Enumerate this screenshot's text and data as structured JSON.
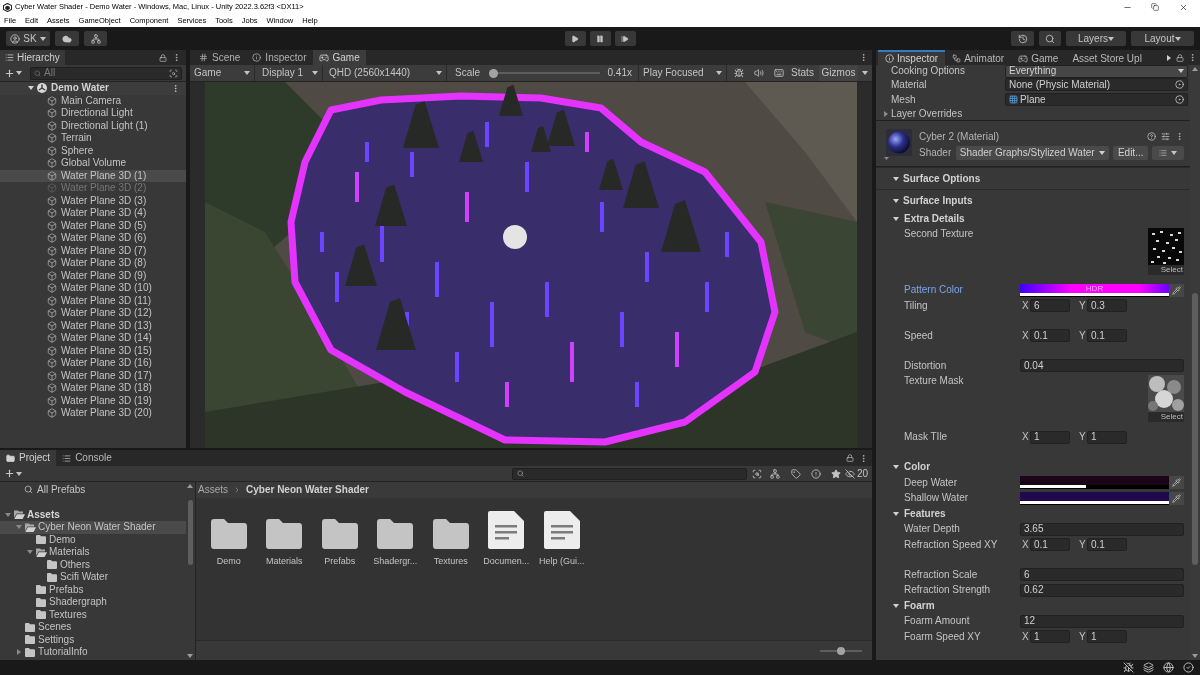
{
  "window": {
    "title": "Cyber Water Shader - Demo Water - Windows, Mac, Linux - Unity 2022.3.62f3 <DX11>"
  },
  "menu": [
    "File",
    "Edit",
    "Assets",
    "GameObject",
    "Component",
    "Services",
    "Tools",
    "Jobs",
    "Window",
    "Help"
  ],
  "toolbar": {
    "account": "SK",
    "layers": "Layers",
    "layout": "Layout"
  },
  "hierarchy": {
    "tab": "Hierarchy",
    "search_placeholder": "All",
    "scene": {
      "label": "Demo Water",
      "expanded": true
    },
    "items": [
      {
        "label": "Main Camera",
        "selected": false,
        "disabled": false
      },
      {
        "label": "Directional Light",
        "selected": false,
        "disabled": false
      },
      {
        "label": "Directional Light (1)",
        "selected": false,
        "disabled": false
      },
      {
        "label": "Terrain",
        "selected": false,
        "disabled": false
      },
      {
        "label": "Sphere",
        "selected": false,
        "disabled": false
      },
      {
        "label": "Global Volume",
        "selected": false,
        "disabled": false
      },
      {
        "label": "Water Plane 3D (1)",
        "selected": true,
        "disabled": false
      },
      {
        "label": "Water Plane 3D (2)",
        "selected": false,
        "disabled": true
      },
      {
        "label": "Water Plane 3D (3)",
        "selected": false,
        "disabled": false
      },
      {
        "label": "Water Plane 3D (4)",
        "selected": false,
        "disabled": false
      },
      {
        "label": "Water Plane 3D (5)",
        "selected": false,
        "disabled": false
      },
      {
        "label": "Water Plane 3D (6)",
        "selected": false,
        "disabled": false
      },
      {
        "label": "Water Plane 3D (7)",
        "selected": false,
        "disabled": false
      },
      {
        "label": "Water Plane 3D (8)",
        "selected": false,
        "disabled": false
      },
      {
        "label": "Water Plane 3D (9)",
        "selected": false,
        "disabled": false
      },
      {
        "label": "Water Plane 3D (10)",
        "selected": false,
        "disabled": false
      },
      {
        "label": "Water Plane 3D (11)",
        "selected": false,
        "disabled": false
      },
      {
        "label": "Water Plane 3D (12)",
        "selected": false,
        "disabled": false
      },
      {
        "label": "Water Plane 3D (13)",
        "selected": false,
        "disabled": false
      },
      {
        "label": "Water Plane 3D (14)",
        "selected": false,
        "disabled": false
      },
      {
        "label": "Water Plane 3D (15)",
        "selected": false,
        "disabled": false
      },
      {
        "label": "Water Plane 3D (16)",
        "selected": false,
        "disabled": false
      },
      {
        "label": "Water Plane 3D (17)",
        "selected": false,
        "disabled": false
      },
      {
        "label": "Water Plane 3D (18)",
        "selected": false,
        "disabled": false
      },
      {
        "label": "Water Plane 3D (19)",
        "selected": false,
        "disabled": false
      },
      {
        "label": "Water Plane 3D (20)",
        "selected": false,
        "disabled": false
      }
    ]
  },
  "game": {
    "tabs": [
      {
        "label": "Scene",
        "selected": false
      },
      {
        "label": "Inspector",
        "selected": false
      },
      {
        "label": "Game",
        "selected": true
      }
    ],
    "mode": "Game",
    "display": "Display 1",
    "resolution": "QHD (2560x1440)",
    "scale": {
      "label": "Scale",
      "level": 0,
      "reading": "0.41x"
    },
    "play_mode": "Play Focused",
    "stats": "Stats",
    "gizmos": "Gizmos"
  },
  "inspector": {
    "tabs": [
      {
        "label": "Inspector",
        "selected": true
      },
      {
        "label": "Animator",
        "selected": false
      },
      {
        "label": "Game",
        "selected": false
      },
      {
        "label": "Asset Store Upl",
        "selected": false
      }
    ],
    "component_rows": [
      {
        "kind": "dropdown",
        "label": "Cooking Options",
        "value": "Everything"
      },
      {
        "kind": "object",
        "label": "Material",
        "value": "None (Physic Material)"
      },
      {
        "kind": "mesh",
        "label": "Mesh",
        "value": "Plane"
      }
    ],
    "layer_overrides": {
      "label": "Layer Overrides",
      "expanded": false
    },
    "material": {
      "name": "Cyber 2 (Material)",
      "expanded": true,
      "shader_label": "Shader",
      "shader": "Shader Graphs/Stylized Water",
      "edit": "Edit..."
    },
    "rows": [
      {
        "kind": "section",
        "label": "Surface Options",
        "expanded": true
      },
      {
        "kind": "section",
        "label": "Surface Inputs",
        "expanded": true
      },
      {
        "kind": "foldout",
        "label": "Extra Details",
        "expanded": true
      },
      {
        "kind": "texture",
        "label": "Second Texture",
        "highlighted": false,
        "select": "Select"
      },
      {
        "kind": "color",
        "label": "Pattern Color",
        "highlighted": true,
        "color": "#ff00ff",
        "badge": "HDR",
        "level": 1
      },
      {
        "kind": "vector2",
        "label": "Tiling",
        "highlighted": false,
        "fields": [
          {
            "axis": "X",
            "value": "6"
          },
          {
            "axis": "Y",
            "value": "0.3"
          }
        ]
      },
      {
        "kind": "vector2",
        "label": "Speed",
        "highlighted": false,
        "fields": [
          {
            "axis": "X",
            "value": "0.1"
          },
          {
            "axis": "Y",
            "value": "0.1"
          }
        ]
      },
      {
        "kind": "float",
        "label": "Distortion",
        "highlighted": false,
        "value": "0.04"
      },
      {
        "kind": "texture",
        "label": "Texture Mask",
        "highlighted": false,
        "select": "Select"
      },
      {
        "kind": "vector2",
        "label": "Mask TIle",
        "highlighted": false,
        "fields": [
          {
            "axis": "X",
            "value": "1"
          },
          {
            "axis": "Y",
            "value": "1"
          }
        ]
      },
      {
        "kind": "foldout",
        "label": "Color",
        "expanded": true
      },
      {
        "kind": "color",
        "label": "Deep Water",
        "highlighted": false,
        "color": "#1c0419",
        "level": 0.44
      },
      {
        "kind": "color",
        "label": "Shallow Water",
        "highlighted": false,
        "color": "#1e0a4c",
        "level": 1
      },
      {
        "kind": "foldout",
        "label": "Features",
        "expanded": true
      },
      {
        "kind": "float",
        "label": "Water Depth",
        "highlighted": false,
        "value": "3.65"
      },
      {
        "kind": "vector2",
        "label": "Refraction Speed XY",
        "highlighted": false,
        "fields": [
          {
            "axis": "X",
            "value": "0.1"
          },
          {
            "axis": "Y",
            "value": "0.1"
          }
        ]
      },
      {
        "kind": "float",
        "label": "Refraction Scale",
        "highlighted": false,
        "value": "6"
      },
      {
        "kind": "float",
        "label": "Refraction Strength",
        "highlighted": false,
        "value": "0.62"
      },
      {
        "kind": "foldout",
        "label": "Foarm",
        "expanded": true
      },
      {
        "kind": "float",
        "label": "Foarm Amount",
        "highlighted": false,
        "value": "12"
      },
      {
        "kind": "vector2",
        "label": "Foarm Speed XY",
        "highlighted": false,
        "fields": [
          {
            "axis": "X",
            "value": "1"
          },
          {
            "axis": "Y",
            "value": "1"
          }
        ]
      }
    ]
  },
  "project": {
    "tabs": [
      {
        "label": "Project",
        "selected": true
      },
      {
        "label": "Console",
        "selected": false
      }
    ],
    "hidden_count": "20",
    "favorites": [
      {
        "label": "All Prefabs",
        "selected": false
      }
    ],
    "tree": [
      {
        "label": "Assets",
        "expanded": true,
        "selected": false,
        "children": [
          {
            "label": "Cyber Neon Water Shader",
            "expanded": true,
            "selected": true,
            "children": [
              {
                "label": "Demo",
                "selected": false
              },
              {
                "label": "Materials",
                "expanded": true,
                "selected": false,
                "children": [
                  {
                    "label": "Others",
                    "selected": false
                  },
                  {
                    "label": "Scifi Water",
                    "selected": false
                  }
                ]
              },
              {
                "label": "Prefabs",
                "selected": false
              },
              {
                "label": "Shadergraph",
                "selected": false
              },
              {
                "label": "Textures",
                "selected": false
              }
            ]
          },
          {
            "label": "Scenes",
            "selected": false
          },
          {
            "label": "Settings",
            "selected": false
          },
          {
            "label": "TutorialInfo",
            "expanded": false,
            "selected": false
          }
        ]
      }
    ],
    "breadcrumb": [
      "Assets",
      "Cyber Neon Water Shader"
    ],
    "items": [
      {
        "kind": "folder",
        "label": "Demo"
      },
      {
        "kind": "folder",
        "label": "Materials"
      },
      {
        "kind": "folder",
        "label": "Prefabs"
      },
      {
        "kind": "folder",
        "label": "Shadergr..."
      },
      {
        "kind": "folder",
        "label": "Textures"
      },
      {
        "kind": "document",
        "label": "Documen..."
      },
      {
        "kind": "document",
        "label": "Help (Gui..."
      }
    ],
    "icon_size": {
      "level": 0.5
    }
  }
}
